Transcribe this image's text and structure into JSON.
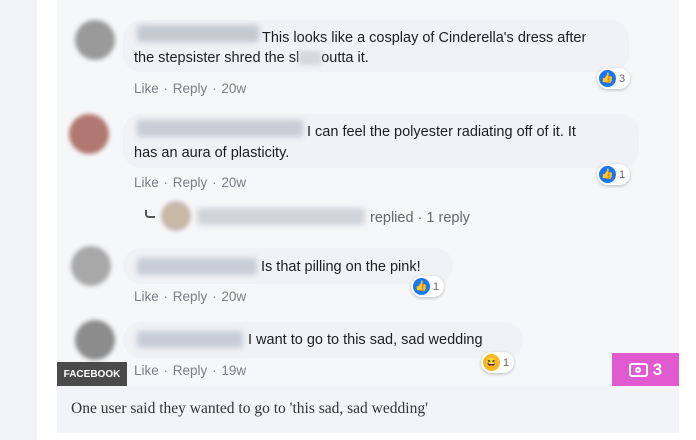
{
  "comments": [
    {
      "text": "This looks like a cosplay of Cinderella's dress after the stepsister shred the sl  outta it.",
      "line1": "This looks like a cosplay of Cinderella's dress after",
      "line2": "the stepsister shred the sl      outta it.",
      "actions": {
        "like": "Like",
        "reply": "Reply",
        "time": "20w"
      },
      "reaction": {
        "type": "like",
        "count": "3"
      }
    },
    {
      "line1": "I can feel the polyester radiating off of it. It",
      "line2": "has an aura of plasticity.",
      "actions": {
        "like": "Like",
        "reply": "Reply",
        "time": "20w"
      },
      "reaction": {
        "type": "like",
        "count": "1"
      }
    },
    {
      "line1": "Is that pilling on the pink!",
      "actions": {
        "like": "Like",
        "reply": "Reply",
        "time": "20w"
      },
      "reaction": {
        "type": "like",
        "count": "1"
      }
    },
    {
      "line1": "I want to go to this sad, sad wedding",
      "actions": {
        "like": "Like",
        "reply": "Reply",
        "time": "19w"
      },
      "reaction": {
        "type": "haha",
        "count": "1"
      }
    }
  ],
  "replies_link": {
    "text": "replied · 1 reply"
  },
  "separator": "·",
  "badges": {
    "source": "FACEBOOK",
    "photo_count": "3"
  },
  "caption": "One user said they wanted to go to 'this sad, sad wedding'",
  "colors": {
    "facebook_blue": "#1877f2",
    "photo_badge": "#e05ad0",
    "source_badge": "#4a4a4a"
  }
}
